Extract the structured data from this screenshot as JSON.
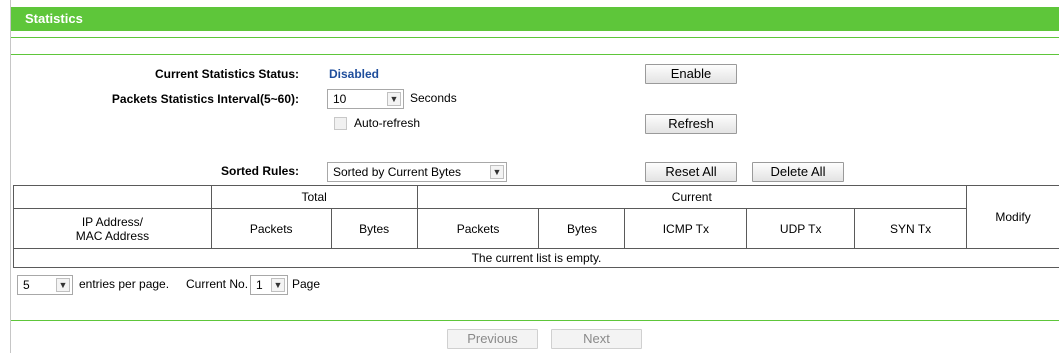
{
  "header": {
    "title": "Statistics"
  },
  "status": {
    "label": "Current Statistics Status:",
    "value": "Disabled",
    "enable_button": "Enable"
  },
  "interval": {
    "label": "Packets Statistics Interval(5~60):",
    "value": "10",
    "unit": "Seconds"
  },
  "auto_refresh": {
    "label": "Auto-refresh",
    "checked": false
  },
  "refresh_button": "Refresh",
  "sorted": {
    "label": "Sorted Rules:",
    "value": "Sorted by Current Bytes"
  },
  "actions": {
    "reset_all": "Reset All",
    "delete_all": "Delete All"
  },
  "table": {
    "group_total": "Total",
    "group_current": "Current",
    "modify": "Modify",
    "ip_mac_line1": "IP Address/",
    "ip_mac_line2": "MAC Address",
    "columns": [
      "Packets",
      "Bytes",
      "Packets",
      "Bytes",
      "ICMP Tx",
      "UDP Tx",
      "SYN Tx"
    ],
    "empty_message": "The current list is empty."
  },
  "pagination": {
    "entries_value": "5",
    "entries_text": "entries per page.",
    "current_no_label": "Current No.",
    "page_value": "1",
    "page_text": "Page",
    "previous": "Previous",
    "next": "Next"
  },
  "colors": {
    "accent": "#5ec63a",
    "status_value": "#1f4e9c"
  },
  "icons": {
    "dropdown": "chevron-down-icon"
  }
}
